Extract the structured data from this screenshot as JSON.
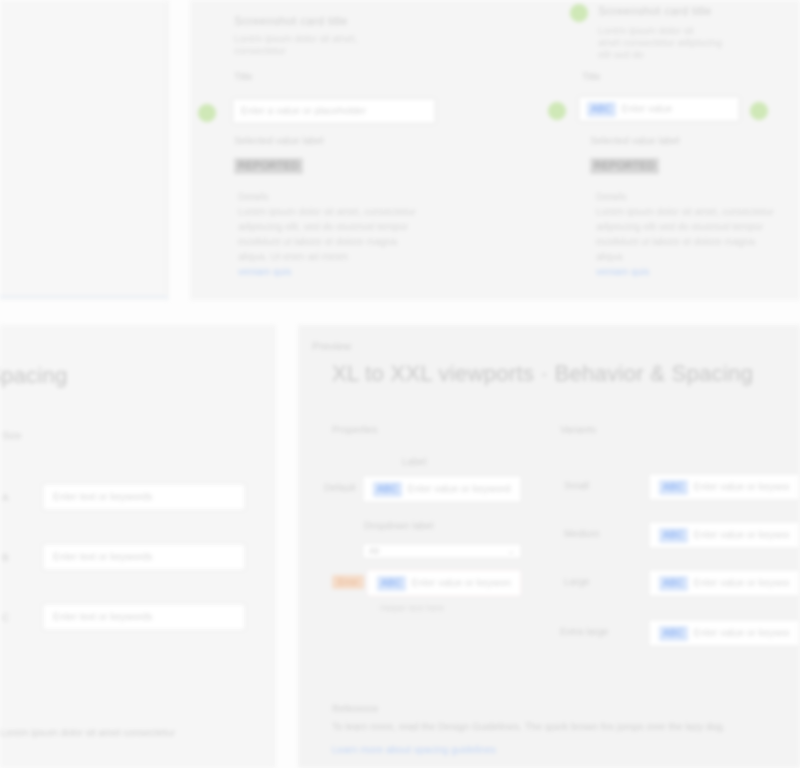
{
  "top": {
    "left_column": {
      "title": "Screenshot card title",
      "subtitle_lines": [
        "Lorem ipsum dolor sit amet,",
        "consectetur"
      ],
      "label": "Title",
      "input_placeholder": "Enter a value or placeholder",
      "section_label": "Selected value label",
      "pill": "REPORTED",
      "body_heading": "Details",
      "body_lines": [
        "Lorem ipsum dolor sit amet, consectetur",
        "adipiscing elit, sed do eiusmod tempor",
        "incididunt ut labore et dolore magna",
        "aliqua. Ut enim ad minim"
      ],
      "body_link": "veniam quis"
    },
    "right_column": {
      "title": "Screenshot card title",
      "subtitle_lines": [
        "Lorem ipsum dolor sit",
        "amet consectetur adipiscing",
        "elit sed do"
      ],
      "label": "Title",
      "chip": "ABC",
      "input_placeholder": "Enter value",
      "section_label": "Selected value label",
      "pill": "REPORTED",
      "body_heading": "Details",
      "body_lines": [
        "Lorem ipsum dolor sit amet, consectetur",
        "adipiscing elit sed do eiusmod tempor",
        "incididunt ut labore et dolore magna aliqua"
      ],
      "body_link": "veniam quis"
    }
  },
  "bottom_left": {
    "title": "Spacing",
    "caption": "Size",
    "inputs": [
      {
        "row": "A",
        "placeholder": "Enter text or keywords"
      },
      {
        "row": "B",
        "placeholder": "Enter text or keywords"
      },
      {
        "row": "C",
        "placeholder": "Enter text or keywords"
      }
    ],
    "footer": "Lorem ipsum dolor sit amet consectetur"
  },
  "bottom_right": {
    "breadcrumb": "Preview",
    "title": "XL to XXL viewports · Behavior & Spacing",
    "left_block": {
      "header": "Properties",
      "small_label": "Label",
      "row_label_1": "Default",
      "chip_1": "ABC",
      "placeholder_1": "Enter value or keywords",
      "dropdown_label": "Dropdown label",
      "dropdown_value": "All",
      "orange_label": "Error",
      "chip_2": "ABC",
      "placeholder_2": "Enter value or keywords",
      "help_text": "Helper text here"
    },
    "right_block": {
      "header": "Variants",
      "rows": [
        {
          "label": "Small",
          "chip": "ABC",
          "placeholder": "Enter value or keywords"
        },
        {
          "label": "Medium",
          "chip": "ABC",
          "placeholder": "Enter value or keywords"
        },
        {
          "label": "Large",
          "chip": "ABC",
          "placeholder": "Enter value or keywords"
        },
        {
          "label": "Extra large",
          "chip": "ABC",
          "placeholder": "Enter value or keywords"
        }
      ]
    },
    "note_heading": "Reference",
    "note_text": "To learn more, read the Design Guidelines. The quick brown fox jumps over the lazy dog.",
    "note_link": "Learn more about spacing guidelines"
  }
}
